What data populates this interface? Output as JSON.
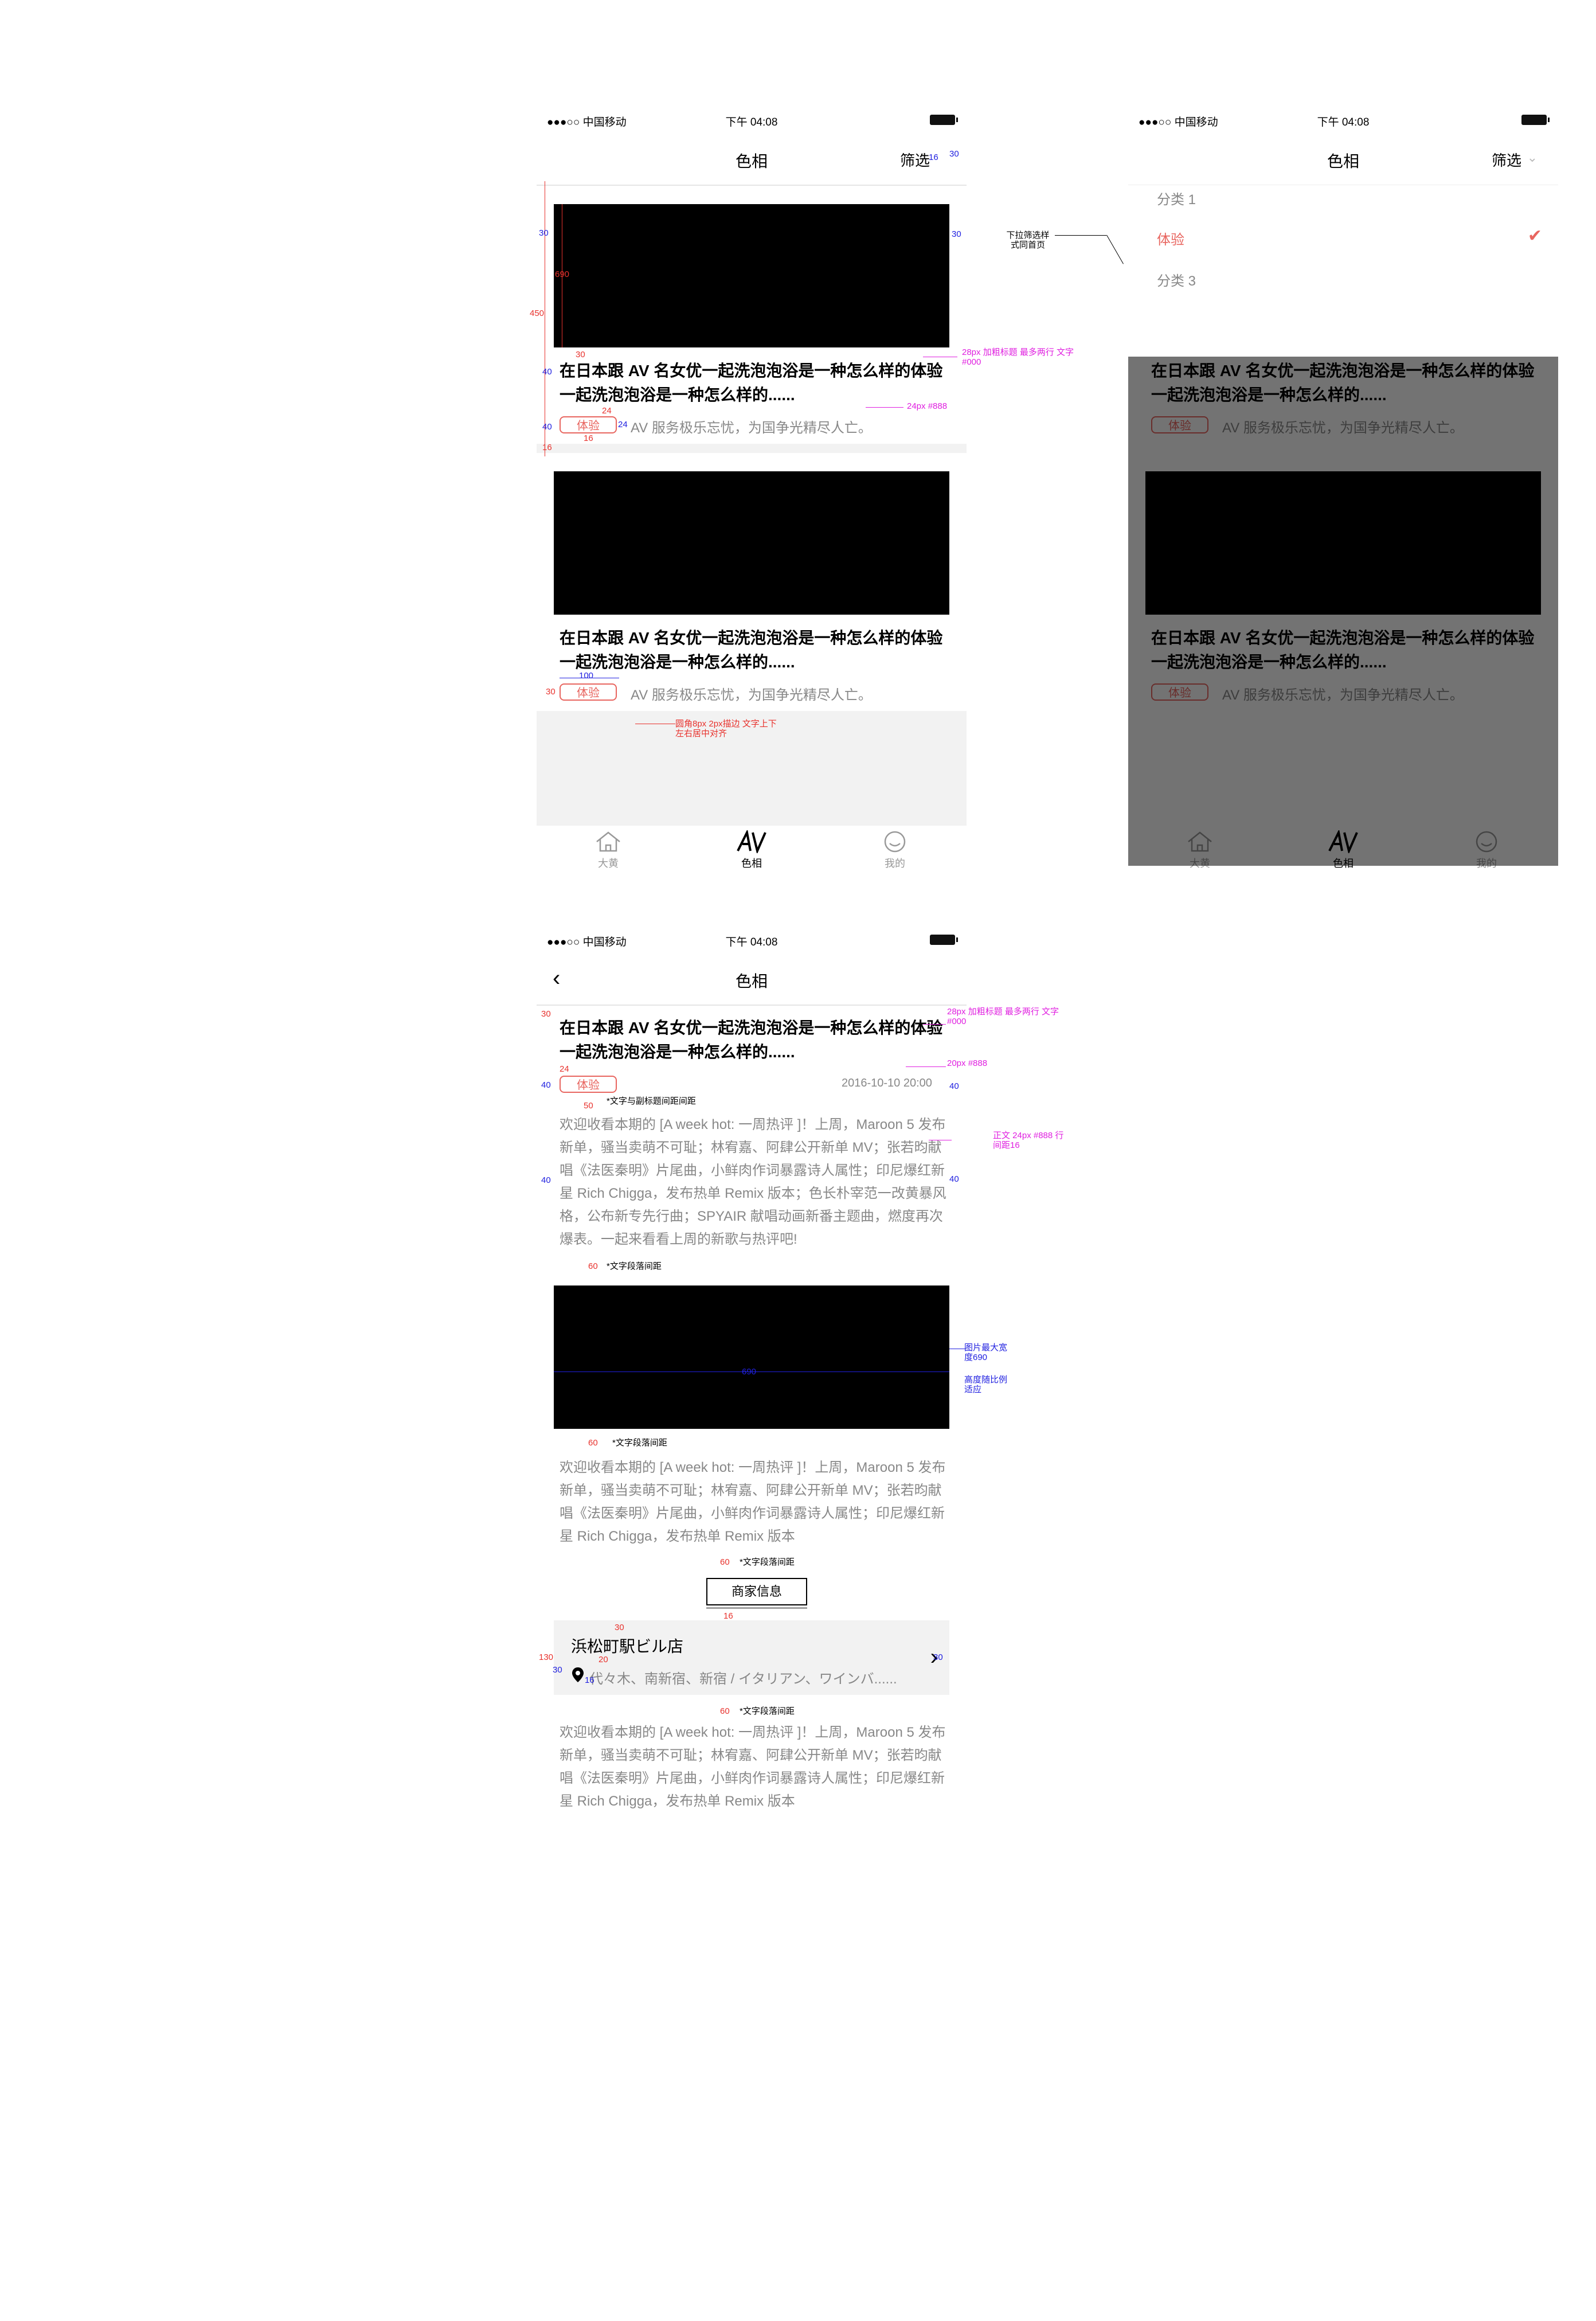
{
  "status": {
    "signal": "●●●○○ 中国移动",
    "time": "下午 04:08"
  },
  "nav": {
    "title": "色相",
    "filter": "筛选",
    "back": "‹"
  },
  "article": {
    "title": "在日本跟 AV 名女优一起洗泡泡浴是一种怎么样的体验一起洗泡泡浴是一种怎么样的......",
    "tag": "体验",
    "desc": "AV 服务极乐忘忧，为国争光精尽人亡。",
    "date": "2016-10-10 20:00"
  },
  "dropdown": {
    "items": [
      "分类 1",
      "体验",
      "分类 3"
    ],
    "selected_index": 1,
    "check": "✔"
  },
  "tabs": [
    {
      "label": "大黄",
      "icon": "home-icon"
    },
    {
      "label": "色相",
      "icon": "av-icon"
    },
    {
      "label": "我的",
      "icon": "smile-icon"
    }
  ],
  "detail": {
    "para1": "欢迎收看本期的 [A week hot: 一周热评 ]！上周，Maroon 5 发布新单，骚当卖萌不可耻；林宥嘉、阿肆公开新单 MV；张若昀献唱《法医秦明》片尾曲，小鲜肉作词暴露诗人属性；印尼爆红新星 Rich Chigga，发布热单 Remix 版本；色长朴宰范一改黄暴风格，公布新专先行曲；SPYAIR 献唱动画新番主题曲，燃度再次爆表。一起来看看上周的新歌与热评吧!",
    "para2": "欢迎收看本期的 [A week hot: 一周热评 ]！上周，Maroon 5 发布新单，骚当卖萌不可耻；林宥嘉、阿肆公开新单 MV；张若昀献唱《法医秦明》片尾曲，小鲜肉作词暴露诗人属性；印尼爆红新星 Rich Chigga，发布热单 Remix 版本",
    "merchant_button": "商家信息",
    "shop_name": "浜松町駅ビル店",
    "shop_addr": "代々木、南新宿、新宿 / イタリアン、ワインバ......",
    "arrow": "›"
  },
  "annotations": {
    "a30": "30",
    "a16": "16",
    "a450": "450",
    "a40": "40",
    "a24": "24",
    "a100": "100",
    "a50": "50",
    "a60": "60",
    "a20": "20",
    "a130": "130",
    "a690": "690",
    "title_spec": "28px 加粗标题  最多两行 文字 #000",
    "desc_spec": "24px #888",
    "tag_spec": "圆角8px  2px描边 文字上下左右居中对齐",
    "dropdown_spec": "下拉筛选样 式同首页",
    "date_spec": "20px #888",
    "body_spec": "正文  24px #888 行间距16",
    "gap_title_sub": "*文字与副标题间距间距",
    "gap_para": "*文字段落间距",
    "img_spec": "图片最大宽 度690",
    "img_spec2": "高度随比例 适应"
  }
}
